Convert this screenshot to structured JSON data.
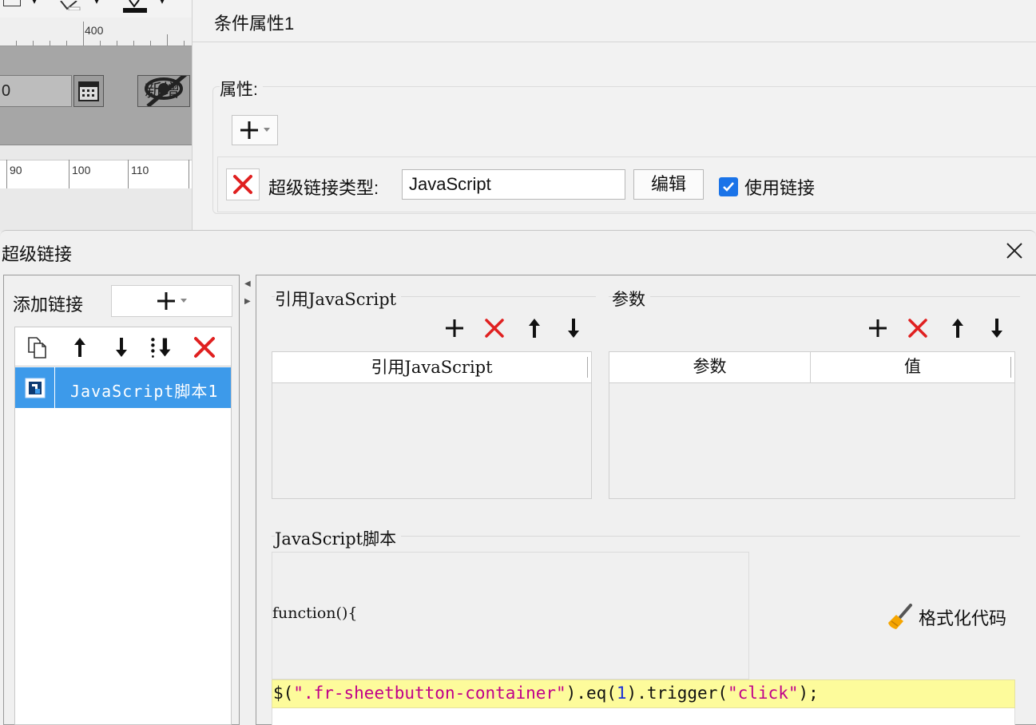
{
  "editor_fragment": {
    "ruler_top_label": "400",
    "date_field_value": "0",
    "hidden_widget_text": "新增",
    "ruler_bottom_labels": [
      "90",
      "100",
      "110"
    ]
  },
  "condition_panel": {
    "title": "条件属性1",
    "attr_group_label": "属性:",
    "link_type_label": "超级链接类型:",
    "link_type_value": "JavaScript",
    "edit_button_label": "编辑",
    "use_link_label": "使用链接",
    "use_link_checked": true
  },
  "dialog": {
    "title": "超级链接",
    "add_link_label": "添加链接",
    "link_items": [
      {
        "label": "JavaScript脚本1",
        "selected": true
      }
    ],
    "js_ref_group": {
      "title": "引用JavaScript",
      "table_header": "引用JavaScript"
    },
    "params_group": {
      "title": "参数",
      "col_param": "参数",
      "col_value": "值"
    },
    "script_group": {
      "title": "JavaScript脚本",
      "line1": "function(){",
      "line2_tokens": [
        {
          "text": "$(",
          "kind": "default"
        },
        {
          "text": "\".fr-sheetbutton-container\"",
          "kind": "string"
        },
        {
          "text": ").eq(",
          "kind": "default"
        },
        {
          "text": "1",
          "kind": "num"
        },
        {
          "text": ").trigger(",
          "kind": "default"
        },
        {
          "text": "\"click\"",
          "kind": "string"
        },
        {
          "text": ");",
          "kind": "default"
        }
      ],
      "format_button_label": "格式化代码"
    }
  },
  "colors": {
    "selection_blue": "#3d9aea",
    "delete_red": "#e02020",
    "checkbox_blue": "#1a73e8",
    "code_highlight": "#fdfb9b"
  }
}
